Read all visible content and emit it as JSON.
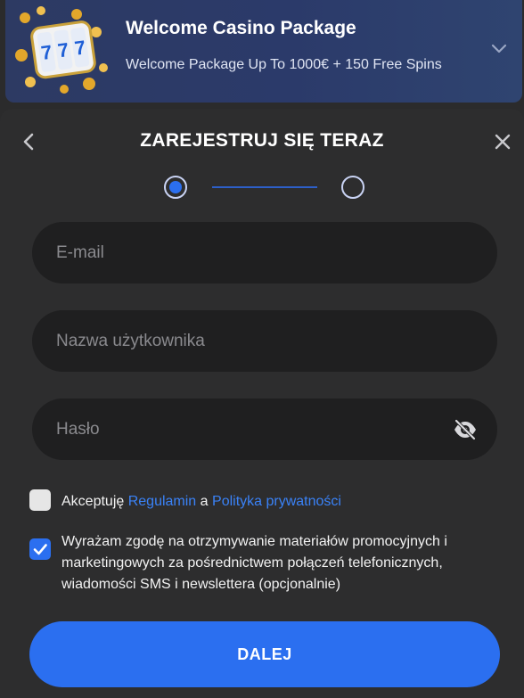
{
  "banner": {
    "title": "Welcome Casino Package",
    "subtitle": "Welcome Package Up To 1000€ + 150 Free Spins",
    "image_icon": "slot-machine-777-icon",
    "expand_icon": "chevron-down-icon"
  },
  "modal": {
    "title": "ZAREJESTRUJ SIĘ TERAZ",
    "back_icon": "chevron-left-icon",
    "close_icon": "close-icon",
    "stepper": {
      "current_step": 1,
      "total_steps": 2
    }
  },
  "form": {
    "email": {
      "placeholder": "E-mail",
      "value": ""
    },
    "username": {
      "placeholder": "Nazwa użytkownika",
      "value": ""
    },
    "password": {
      "placeholder": "Hasło",
      "value": "",
      "toggle_icon": "eye-off-icon"
    },
    "terms": {
      "checked": false,
      "prefix": "Akceptuję",
      "link1": "Regulamin",
      "middle": "a",
      "link2": "Polityka prywatności"
    },
    "consent": {
      "checked": true,
      "text": "Wyrażam zgodę na otrzymywanie materiałów promocyjnych i marketingowych za pośrednictwem połączeń telefonicznych, wiadomości SMS i newslettera (opcjonalnie)"
    },
    "submit_label": "DALEJ"
  },
  "colors": {
    "accent": "#2b6ff0",
    "link": "#3a82f7",
    "panel_bg": "#2d2d2e",
    "field_bg": "#1f1f20",
    "banner_bg": "#2b3a6a"
  }
}
